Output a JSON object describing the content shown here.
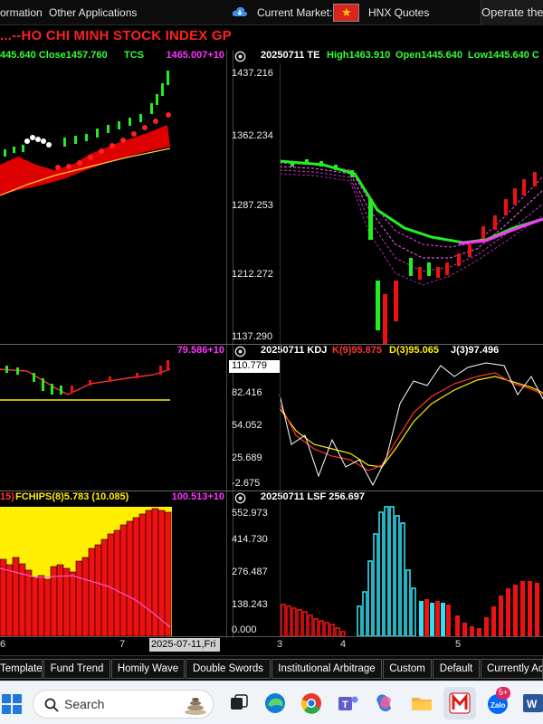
{
  "topbar": {
    "info_label": "ormation",
    "other_apps": "Other Applications",
    "current_market": "Current Market:",
    "market_name": "HNX Quotes",
    "operate_label": "Operate the Fa"
  },
  "title": "...--HO CHI MINH STOCK INDEX  GP",
  "panes": {
    "left_top": {
      "header": "445.640 Close1457.760",
      "indicator": "TCS",
      "value": "1465.007+10"
    },
    "right_top": {
      "header": "20250711 TE",
      "high": "High1463.910",
      "open": "Open1445.640",
      "low": "Low1445.640 C"
    },
    "left_mid": {
      "value": "79.586+10"
    },
    "right_mid": {
      "header": "20250711 KDJ",
      "k": "K(9)95.875",
      "d": "D(3)95.065",
      "j": "J(3)97.496"
    },
    "left_bot": {
      "header_a": "15)",
      "header_b": "FCHIPS(8)5.783 (10.085)",
      "value": "100.513+10"
    },
    "right_bot": {
      "header": "20250711 LSF 256.697"
    }
  },
  "y_axis_top": [
    "1437.216",
    "1362.234",
    "1287.253",
    "1212.272",
    "1137.290"
  ],
  "y_axis_mid": [
    "110.779",
    "82.416",
    "54.052",
    "25.689",
    "-2.675"
  ],
  "y_axis_bot": [
    "552.973",
    "414.730",
    "276.487",
    "138.243",
    "0.000"
  ],
  "x_axis": {
    "left": [
      "6",
      "7"
    ],
    "date": "2025-07-11,Fri",
    "right": [
      "3",
      "4",
      "5"
    ]
  },
  "tabs": [
    "Template",
    "Fund Trend",
    "Homily Wave",
    "Double Swords",
    "Institutional Arbitrage",
    "Custom",
    "Default",
    "Currently Acti"
  ],
  "taskbar": {
    "search_placeholder": "Search",
    "badge": "5+"
  },
  "icons": [
    "cloud-icon",
    "vietnam-flag-icon",
    "settings-icon",
    "windows-start-icon",
    "search-icon",
    "task-view-icon",
    "edge-icon",
    "chrome-icon",
    "teams-icon",
    "copilot-icon",
    "file-explorer-icon",
    "stock-app-icon",
    "zalo-icon",
    "word-icon"
  ],
  "colors": {
    "title": "#ff2020",
    "up": "#22ee22",
    "down": "#ee1111",
    "magenta": "#ff33ff",
    "yellow": "#ffee00",
    "cyan": "#33ddee"
  }
}
